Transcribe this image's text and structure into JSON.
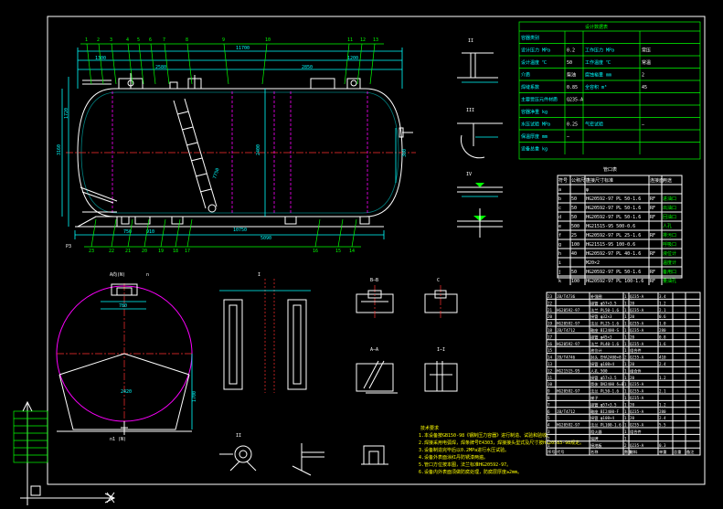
{
  "drawing": {
    "frame_color": "#ffffff",
    "accent_cyan": "#00ffff",
    "accent_green": "#00ff00",
    "center_line_red": "#ff3030",
    "outline_magenta": "#ff00ff"
  },
  "main_view": {
    "balloons_top": [
      "1",
      "2",
      "3",
      "4",
      "5",
      "6",
      "7",
      "8",
      "9",
      "10",
      "11",
      "12",
      "13"
    ],
    "balloons_bottom": [
      "23",
      "22",
      "21",
      "20",
      "19",
      "18",
      "17",
      "16",
      "15",
      "14"
    ],
    "left_marks": [
      "P3"
    ],
    "dimensions": {
      "total_length": "11700",
      "shell_length": "10750",
      "diameter": "2400",
      "height": "3160",
      "left_height": "1720",
      "dim_1200": "1200",
      "dim_1300": "1300",
      "dim_750": "750",
      "dim_910": "910",
      "dim_5090": "5090",
      "dim_2580": "2580",
      "dim_2850": "2850",
      "dim_7750": "7750",
      "dim_300": "300"
    }
  },
  "side_view": {
    "title": "A向(N)",
    "label_n": "n",
    "bottom_note": "n1 (N)",
    "dim_2420": "2420",
    "dim_780": "780",
    "dim_1700": "1700"
  },
  "detail_titles": {
    "d1": "I",
    "d2": "II",
    "d3": "III",
    "d4": "IV",
    "d5": "B—B",
    "d6": "C",
    "d7": "A—A",
    "d8": "I—I",
    "d9": "II"
  },
  "notes": {
    "title": "技术要求",
    "lines": [
      "1.本设备按GB150-98《钢制压力容器》进行制造、试验和验收。",
      "2.焊接采用电弧焊，焊条牌号E4303，焊接接头型式及尺寸按HG20583-98规定。",
      "3.设备制造完毕后以0.2MPa进行水压试验。",
      "4.设备外表面涂红丹防锈漆两遍。",
      "5.管口方位按本图，法兰标准HG20592-97。",
      "6.设备内外表面须做防腐处理，防腐层厚度≥2mm。"
    ]
  },
  "design_table": {
    "title": "设计数据表",
    "rows": [
      [
        "容器类别",
        "",
        "",
        ""
      ],
      [
        "设计压力 MPa",
        "0.2",
        "工作压力 MPa",
        "常压"
      ],
      [
        "设计温度 ℃",
        "50",
        "工作温度 ℃",
        "常温"
      ],
      [
        "介质",
        "柴油",
        "腐蚀裕量 mm",
        "2"
      ],
      [
        "焊缝系数",
        "0.85",
        "全容积 m³",
        "45"
      ],
      [
        "主要受压元件材质",
        "Q235-A",
        "",
        ""
      ],
      [
        "容器净重 kg",
        "",
        "",
        ""
      ],
      [
        "水压试验 MPa",
        "0.25",
        "气密试验",
        "—"
      ],
      [
        "保温厚度 mm",
        "—",
        "",
        ""
      ],
      [
        "设备总重 kg",
        "",
        "",
        ""
      ]
    ]
  },
  "nozzle_table": {
    "title": "管口表",
    "header": [
      "符号",
      "公称尺寸",
      "连接尺寸标准",
      "连接面",
      "用途"
    ],
    "rows": [
      [
        "a",
        "",
        "φ",
        "",
        " "
      ],
      [
        "b",
        "50",
        "HG20592-97 PL 50-1.6",
        "RF",
        "进油口"
      ],
      [
        "c",
        "50",
        "HG20592-97 PL 50-1.6",
        "RF",
        "出油口"
      ],
      [
        "d",
        "50",
        "HG20592-97 PL 50-1.6",
        "RF",
        "回油口"
      ],
      [
        "e",
        "500",
        "HG21515-95 500-0.6",
        "",
        "人孔"
      ],
      [
        "f",
        "25",
        "HG20592-97 PL 25-1.6",
        "RF",
        "排污口"
      ],
      [
        "g",
        "100",
        "HG21515-95 100-0.6",
        "",
        "呼吸口"
      ],
      [
        "h",
        "40",
        "HG20592-97 PL 40-1.6",
        "RF",
        "液位计"
      ],
      [
        "i",
        "",
        "M20×2",
        "",
        "温度计"
      ],
      [
        "j",
        "50",
        "HG20592-97 PL 50-1.6",
        "RF",
        "备用口"
      ],
      [
        "k",
        "100",
        "HG20592-97 PL 100-1.6",
        "RF",
        "量油孔"
      ]
    ]
  },
  "bom_table": {
    "header": [
      "序号",
      "代号",
      "名称",
      "数量",
      "材料",
      "单重",
      "总重",
      "备注"
    ],
    "rows": [
      [
        "23",
        "JB/T4736",
        "补强圈",
        "1",
        "Q235-A",
        "3.4",
        "",
        ""
      ],
      [
        "22",
        "",
        "接管 φ57×3.5",
        "1",
        "20",
        "1.2",
        "",
        ""
      ],
      [
        "21",
        "HG20592-97",
        "法兰 PL50-1.6",
        "1",
        "Q235-A",
        "2.1",
        "",
        ""
      ],
      [
        "20",
        "",
        "接管 φ32×3",
        "1",
        "20",
        "0.6",
        "",
        ""
      ],
      [
        "19",
        "HG20592-97",
        "法兰 PL25-1.6",
        "1",
        "Q235-A",
        "1.0",
        "",
        ""
      ],
      [
        "18",
        "JB/T4712",
        "鞍座 BI2400-S",
        "1",
        "Q235-A",
        "280",
        "",
        ""
      ],
      [
        "17",
        "",
        "接管 φ45×3",
        "1",
        "20",
        "0.8",
        "",
        ""
      ],
      [
        "16",
        "HG20592-97",
        "法兰 PL40-1.6",
        "1",
        "Q235-A",
        "1.6",
        "",
        ""
      ],
      [
        "15",
        "",
        "液位计",
        "1",
        "组合件",
        "",
        "",
        ""
      ],
      [
        "14",
        "JB/T4746",
        "封头 EHA2400×8",
        "2",
        "Q235-A",
        "410",
        "",
        ""
      ],
      [
        "13",
        "",
        "接管 φ108×4",
        "1",
        "20",
        "2.4",
        "",
        ""
      ],
      [
        "12",
        "HG21515-95",
        "人孔 500",
        "1",
        "组合件",
        "",
        "",
        ""
      ],
      [
        "11",
        "",
        "接管 φ57×3.5",
        "1",
        "20",
        "1.2",
        "",
        ""
      ],
      [
        "10",
        "",
        "筒体 DN2400 δ=8",
        "1",
        "Q235-A",
        "",
        "",
        ""
      ],
      [
        "9",
        "HG20592-97",
        "法兰 PL50-1.6",
        "1",
        "Q235-A",
        "2.1",
        "",
        ""
      ],
      [
        "8",
        "",
        "梯子",
        "1",
        "Q235-A",
        "",
        "",
        ""
      ],
      [
        "7",
        "",
        "接管 φ57×3.5",
        "1",
        "20",
        "1.2",
        "",
        ""
      ],
      [
        "6",
        "JB/T4712",
        "鞍座 BI2400-F",
        "1",
        "Q235-A",
        "280",
        "",
        ""
      ],
      [
        "5",
        "",
        "接管 φ108×4",
        "1",
        "20",
        "2.4",
        "",
        ""
      ],
      [
        "4",
        "HG20592-97",
        "法兰 PL100-1.6",
        "1",
        "Q235-A",
        "5.5",
        "",
        ""
      ],
      [
        "3",
        "",
        "阻火器",
        "1",
        "组合件",
        "",
        "",
        ""
      ],
      [
        "2",
        "",
        "铭牌",
        "1",
        "",
        "",
        "",
        ""
      ],
      [
        "1",
        "",
        "接地板",
        "2",
        "Q235-A",
        "0.3",
        "",
        ""
      ]
    ]
  }
}
